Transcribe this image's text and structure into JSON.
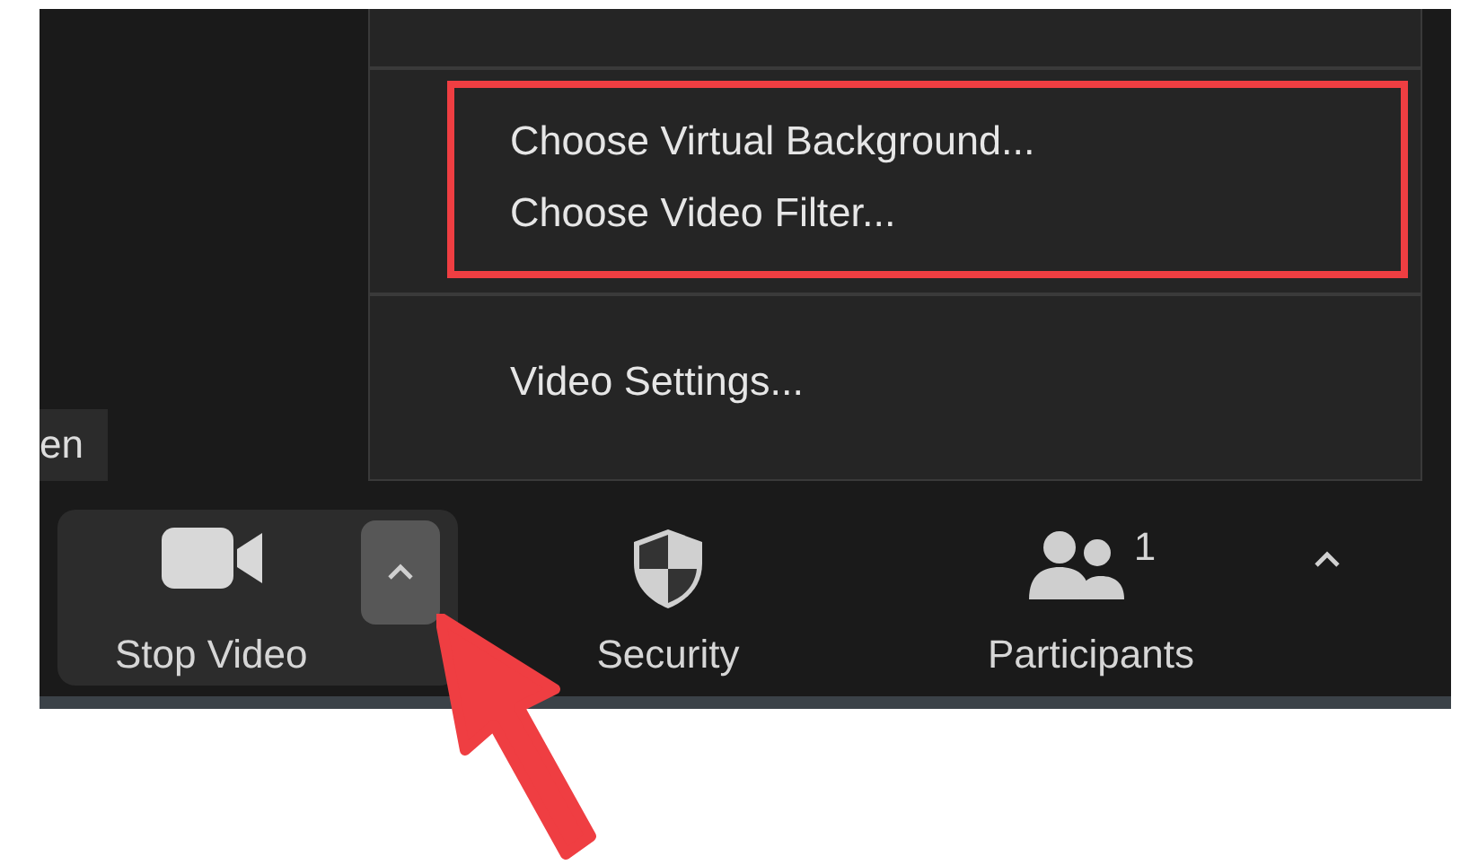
{
  "menu": {
    "sections": [
      {
        "highlighted": true,
        "items": [
          "Choose Virtual Background...",
          "Choose Video Filter..."
        ]
      },
      {
        "highlighted": false,
        "items": [
          "Video Settings..."
        ]
      }
    ]
  },
  "side_label": "en",
  "toolbar": [
    {
      "kind": "video",
      "label": "Stop Video",
      "selected": true,
      "caret": true,
      "caret_open": true
    },
    {
      "kind": "security",
      "label": "Security",
      "selected": false
    },
    {
      "kind": "participants",
      "label": "Participants",
      "count": "1",
      "selected": false,
      "caret": true,
      "caret_open": false
    }
  ],
  "annotation": {
    "arrow": true
  }
}
